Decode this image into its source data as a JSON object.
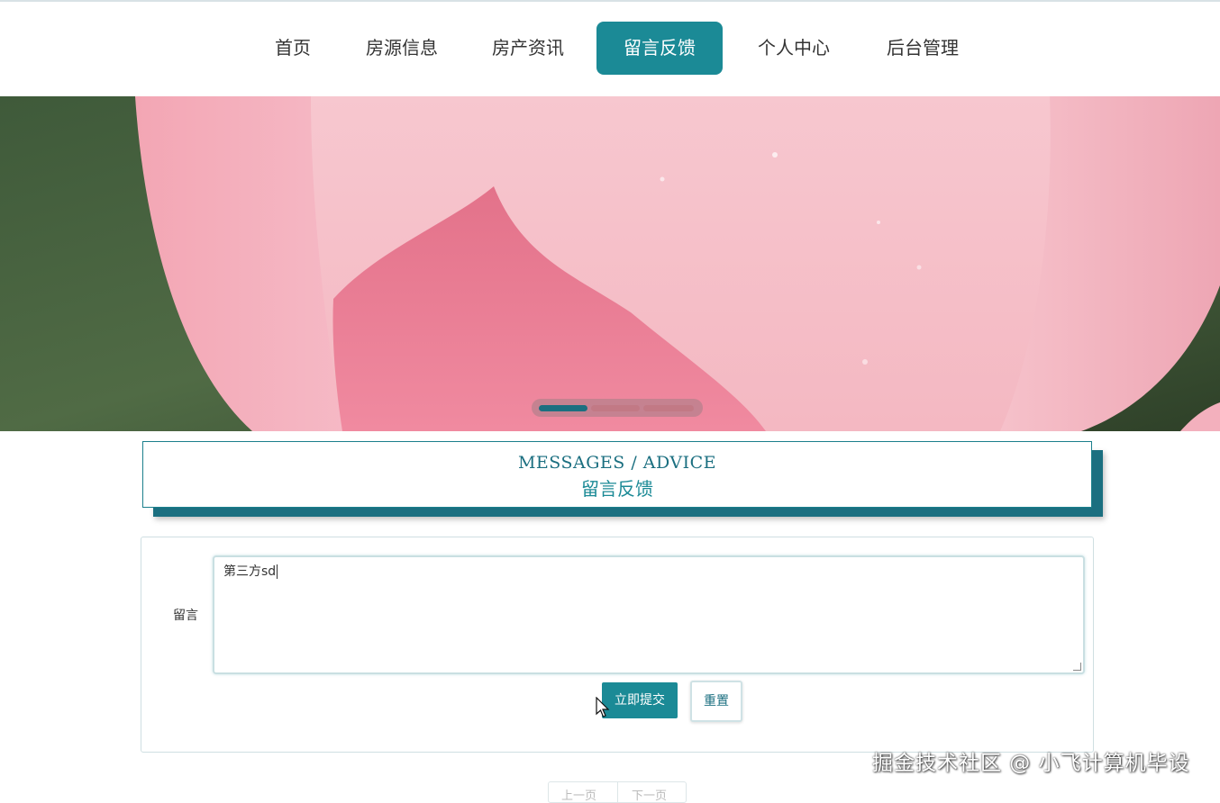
{
  "nav": {
    "items": [
      {
        "label": "首页"
      },
      {
        "label": "房源信息"
      },
      {
        "label": "房产资讯"
      },
      {
        "label": "留言反馈"
      },
      {
        "label": "个人中心"
      },
      {
        "label": "后台管理"
      }
    ],
    "active_index": 3
  },
  "banner": {
    "carousel_dots": 3,
    "active_dot": 0
  },
  "section": {
    "title_en": "MESSAGES / ADVICE",
    "title_cn": "留言反馈"
  },
  "form": {
    "label": "留言",
    "message_value": "第三方sd",
    "submit_label": "立即提交",
    "reset_label": "重置"
  },
  "pager": {
    "prev_label": "上一页",
    "next_label": "下一页"
  },
  "watermark": "掘金技术社区 @ 小飞计算机毕设",
  "colors": {
    "accent": "#1b8a96",
    "accent_dark": "#1b6f80"
  }
}
